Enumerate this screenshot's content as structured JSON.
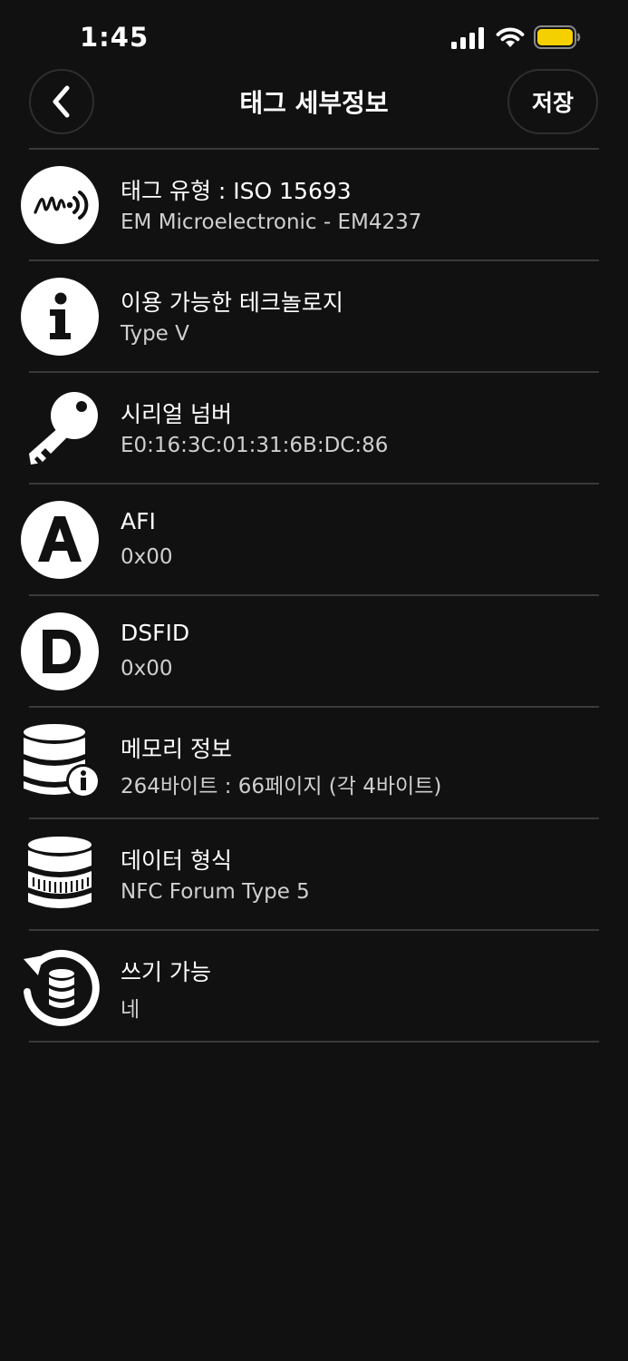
{
  "status_bar": {
    "time": "1:45"
  },
  "nav": {
    "title": "태그 세부정보",
    "save_label": "저장"
  },
  "colors": {
    "background": "#111111",
    "divider": "#3a3a3a",
    "battery": "#f5d000",
    "text_secondary": "#cfcfcf"
  },
  "rows": [
    {
      "icon": "nfc-wave-icon",
      "title": "태그 유형 : ISO 15693",
      "value": "EM Microelectronic - EM4237"
    },
    {
      "icon": "info-icon",
      "title": "이용 가능한 테크놀로지",
      "value": "Type V"
    },
    {
      "icon": "key-icon",
      "title": "시리얼 넘버",
      "value": "E0:16:3C:01:31:6B:DC:86"
    },
    {
      "icon": "letter-a-icon",
      "title": "AFI",
      "value": "0x00"
    },
    {
      "icon": "letter-d-icon",
      "title": "DSFID",
      "value": "0x00"
    },
    {
      "icon": "database-info-icon",
      "title": "메모리 정보",
      "value": "264바이트 : 66페이지 (각 4바이트)"
    },
    {
      "icon": "database-barcode-icon",
      "title": "데이터 형식",
      "value": "NFC Forum Type 5"
    },
    {
      "icon": "database-rewrite-icon",
      "title": "쓰기 가능",
      "value": "네"
    }
  ]
}
